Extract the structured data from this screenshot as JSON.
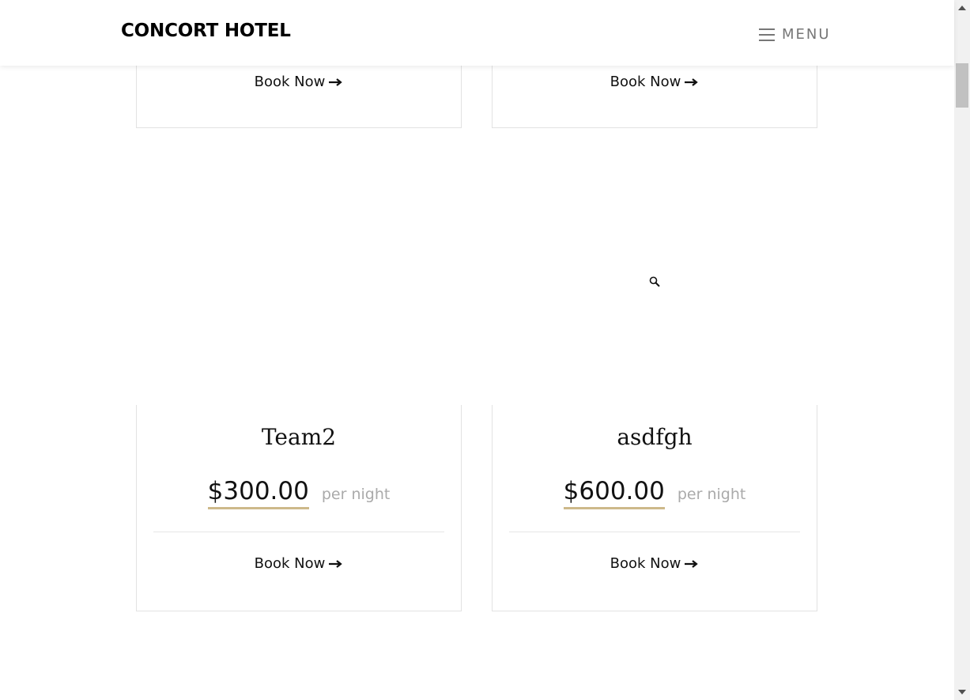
{
  "header": {
    "brand": "CONCORT HOTEL",
    "menu_label": "MENU"
  },
  "top_cards": [
    {
      "book_label": "Book Now"
    },
    {
      "book_label": "Book Now"
    }
  ],
  "rooms": [
    {
      "name": "Team2",
      "price": "$300.00",
      "per_night": "per night",
      "book_label": "Book Now"
    },
    {
      "name": "asdfgh",
      "price": "$600.00",
      "per_night": "per night",
      "book_label": "Book Now"
    }
  ],
  "icons": {
    "menu": "hamburger-icon",
    "book": "arrow-right-icon",
    "zoom": "search-icon"
  },
  "colors": {
    "price_underline": "#cdb98a",
    "per_night_text": "#aaaaaa",
    "card_border": "#e2e2e2"
  }
}
